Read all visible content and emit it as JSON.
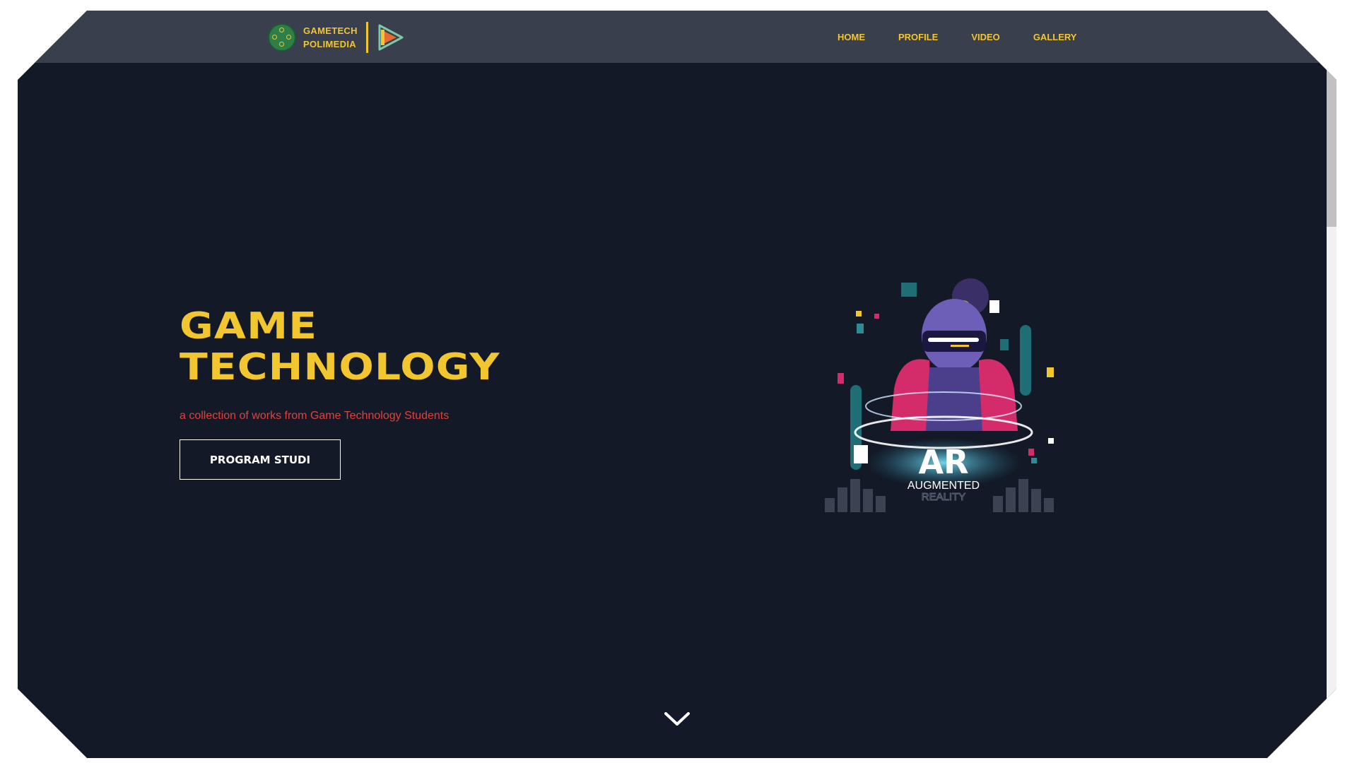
{
  "navbar": {
    "logo_line1": "GAMETECH",
    "logo_line2": "POLIMEDIA",
    "links": [
      "HOME",
      "PROFILE",
      "VIDEO",
      "GALLERY"
    ]
  },
  "hero": {
    "title_line1": "GAME",
    "title_line2": "TECHNOLOGY",
    "subtitle": "a collection of works from Game Technology Students",
    "button_label": "PROGRAM STUDI"
  },
  "illustration": {
    "label_big": "AR",
    "label_line1": "AUGMENTED",
    "label_line2": "REALITY"
  },
  "icons": {
    "scroll_down": "chevron-down-icon",
    "logo_badge": "gamepad-badge-icon",
    "logo_play": "play-icon"
  },
  "colors": {
    "background": "#141927",
    "navbar": "#3a3f4d",
    "accent": "#f2c62e",
    "subtitle": "#e0413b"
  }
}
